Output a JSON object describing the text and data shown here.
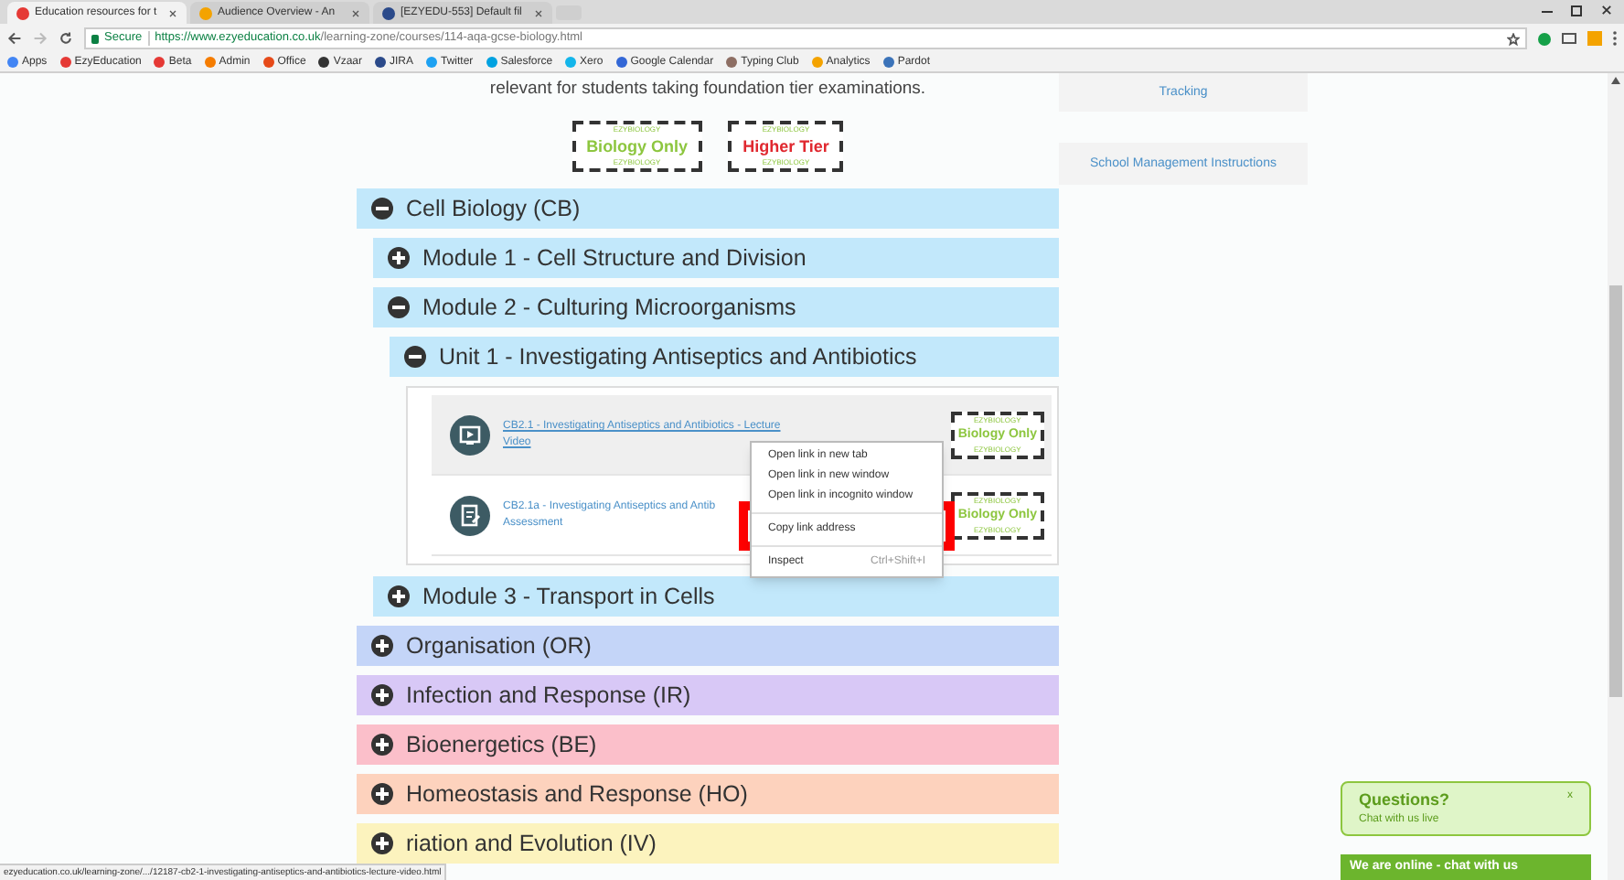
{
  "browser": {
    "tabs": [
      {
        "title": "Education resources for t",
        "selected": true
      },
      {
        "title": "Audience Overview - An",
        "selected": false
      },
      {
        "title": "[EZYEDU-553] Default fil",
        "selected": false
      }
    ],
    "secure_label": "Secure",
    "url_host": "https://www.ezyeducation.co.uk",
    "url_path": "/learning-zone/courses/114-aqa-gcse-biology.html",
    "bookmarks": [
      "Apps",
      "EzyEducation",
      "Beta",
      "Admin",
      "Office",
      "Vzaar",
      "JIRA",
      "Twitter",
      "Salesforce",
      "Xero",
      "Google Calendar",
      "Typing Club",
      "Analytics",
      "Pardot"
    ]
  },
  "intro": "relevant for students taking foundation tier examinations.",
  "legend": [
    {
      "tag_top": "EZYBIOLOGY",
      "label": "Biology Only",
      "tag_bottom": "EZYBIOLOGY",
      "color": "#8dc63f"
    },
    {
      "tag_top": "EZYBIOLOGY",
      "label": "Higher Tier",
      "tag_bottom": "EZYBIOLOGY",
      "color": "#e0282f"
    }
  ],
  "topics": [
    {
      "kind": "section",
      "title": "Cell Biology (CB)",
      "color": "#c2e8fb",
      "expanded": true,
      "children": [
        {
          "kind": "section",
          "title": "Module 1 - Cell Structure and Division",
          "color": "#c2e8fb",
          "expanded": false
        },
        {
          "kind": "section",
          "title": "Module 2 - Culturing Microorganisms",
          "color": "#c2e8fb",
          "expanded": true,
          "children": [
            {
              "kind": "section",
              "title": "Unit 1 - Investigating Antiseptics and Antibiotics",
              "color": "#c2e8fb",
              "expanded": true,
              "children": [
                {
                  "kind": "video",
                  "lines": [
                    "CB2.1 - Investigating Antiseptics and Antibiotics - Lecture",
                    "Video"
                  ],
                  "selected": true,
                  "badge": {
                    "tag_top": "EZYBIOLOGY",
                    "label": "Biology Only",
                    "tag_bottom": "EZYBIOLOGY",
                    "color": "#8dc63f"
                  }
                },
                {
                  "kind": "assessment",
                  "lines": [
                    "CB2.1a - Investigating Antiseptics and Antib",
                    "Assessment"
                  ],
                  "selected": false,
                  "badge": {
                    "tag_top": "EZYBIOLOGY",
                    "label": "Biology Only",
                    "tag_bottom": "EZYBIOLOGY",
                    "color": "#8dc63f"
                  }
                }
              ]
            }
          ]
        },
        {
          "kind": "section",
          "title": "Module 3 - Transport in Cells",
          "color": "#c2e8fb",
          "expanded": false
        }
      ]
    },
    {
      "kind": "section",
      "title": "Organisation (OR)",
      "color": "#c4d5f8",
      "expanded": false
    },
    {
      "kind": "section",
      "title": "Infection and Response (IR)",
      "color": "#d8c8f6",
      "expanded": false
    },
    {
      "kind": "section",
      "title": "Bioenergetics (BE)",
      "color": "#fbbfca",
      "expanded": false
    },
    {
      "kind": "section",
      "title": "Homeostasis and Response (HO)",
      "color": "#fdd2bd",
      "expanded": false
    },
    {
      "kind": "section",
      "title": "riation and Evolution (IV)",
      "color": "#fcf3be",
      "expanded": false
    }
  ],
  "sidebar": [
    "Tracking",
    "School Management Instructions"
  ],
  "context_menu": [
    {
      "kind": "item",
      "label": "Open link in new tab",
      "annotated": false
    },
    {
      "kind": "item",
      "label": "Open link in new window",
      "annotated": false
    },
    {
      "kind": "item",
      "label": "Open link in incognito window",
      "annotated": false
    },
    {
      "kind": "separator"
    },
    {
      "kind": "item",
      "label": "Copy link address",
      "annotated": true
    },
    {
      "kind": "separator"
    },
    {
      "kind": "item",
      "label": "Inspect",
      "shortcut": "Ctrl+Shift+I",
      "annotated": false
    }
  ],
  "status_url": "ezyeducation.co.uk/learning-zone/.../12187-cb2-1-investigating-antiseptics-and-antibiotics-lecture-video.html",
  "chat": {
    "title": "Questions?",
    "subtitle": "Chat with us live",
    "close": "x",
    "bar": "We are online - chat with us"
  }
}
